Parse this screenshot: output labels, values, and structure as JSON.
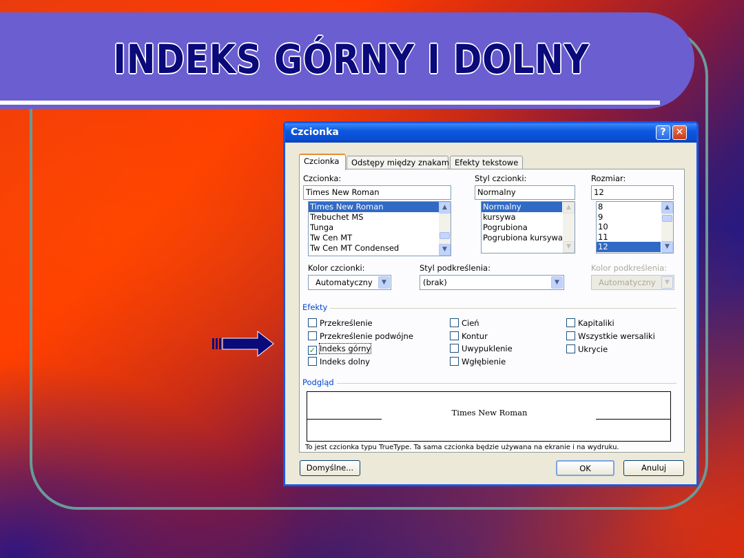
{
  "slide": {
    "title": "INDEKS GÓRNY I DOLNY",
    "colors": {
      "title_bar": "#6a5ed0",
      "title_text": "#0a0a7a",
      "frame": "#6a9a98"
    }
  },
  "dialog": {
    "title": "Czcionka",
    "help_glyph": "?",
    "close_glyph": "✕",
    "tabs": [
      {
        "label": "Czcionka",
        "active": true
      },
      {
        "label": "Odstępy między znakami",
        "active": false
      },
      {
        "label": "Efekty tekstowe",
        "active": false
      }
    ],
    "font": {
      "label": "Czcionka:",
      "value": "Times New Roman",
      "items": [
        "Times New Roman",
        "Trebuchet MS",
        "Tunga",
        "Tw Cen MT",
        "Tw Cen MT Condensed"
      ],
      "selected": "Times New Roman"
    },
    "style": {
      "label": "Styl czcionki:",
      "value": "Normalny",
      "items": [
        "Normalny",
        "kursywa",
        "Pogrubiona",
        "Pogrubiona kursywa"
      ],
      "selected": "Normalny"
    },
    "size": {
      "label": "Rozmiar:",
      "value": "12",
      "items": [
        "8",
        "9",
        "10",
        "11",
        "12"
      ],
      "selected": "12"
    },
    "font_color": {
      "label": "Kolor czcionki:",
      "value": "Automatyczny"
    },
    "underline_style": {
      "label": "Styl podkreślenia:",
      "value": "(brak)"
    },
    "underline_color": {
      "label": "Kolor podkreślenia:",
      "value": "Automatyczny",
      "disabled": true
    },
    "effects": {
      "label": "Efekty",
      "items": [
        {
          "label": "Przekreślenie",
          "checked": false
        },
        {
          "label": "Przekreślenie podwójne",
          "checked": false
        },
        {
          "label": "Indeks górny",
          "checked": true
        },
        {
          "label": "Indeks dolny",
          "checked": false
        },
        {
          "label": "Cień",
          "checked": false
        },
        {
          "label": "Kontur",
          "checked": false
        },
        {
          "label": "Uwypuklenie",
          "checked": false
        },
        {
          "label": "Wgłębienie",
          "checked": false
        },
        {
          "label": "Kapitaliki",
          "checked": false
        },
        {
          "label": "Wszystkie wersaliki",
          "checked": false
        },
        {
          "label": "Ukrycie",
          "checked": false
        }
      ]
    },
    "preview": {
      "label": "Podgląd",
      "text": "Times New Roman",
      "note": "To jest czcionka typu TrueType. Ta sama czcionka będzie używana na ekranie i na wydruku."
    },
    "buttons": {
      "default": "Domyślne...",
      "ok": "OK",
      "cancel": "Anuluj"
    }
  }
}
